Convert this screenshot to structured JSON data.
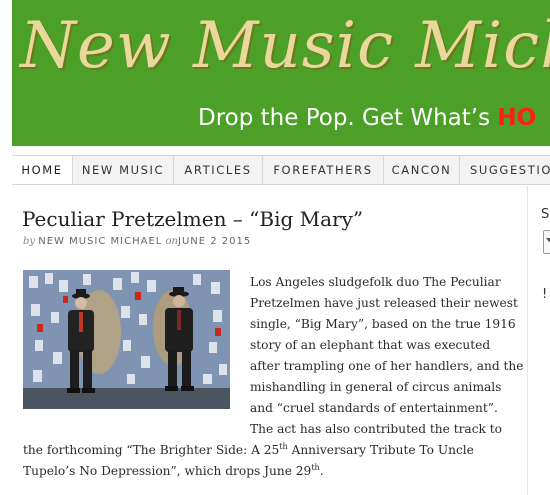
{
  "header": {
    "site_title": "New Music Michael",
    "tagline_prefix": "Drop the Pop. Get What’s ",
    "tagline_hot": "HO",
    "bg_color": "#4ca028",
    "title_color": "#ead79b",
    "hot_color": "#ff1e16"
  },
  "nav": {
    "items": [
      {
        "label": "HOME",
        "active": true
      },
      {
        "label": "NEW MUSIC",
        "active": false
      },
      {
        "label": "ARTICLES",
        "active": false
      },
      {
        "label": "FOREFATHERS",
        "active": false
      },
      {
        "label": "CANCON",
        "active": false
      },
      {
        "label": "SUGGESTIO",
        "active": false
      }
    ]
  },
  "post": {
    "title": "Peculiar Pretzelmen – “Big Mary”",
    "by": "by",
    "author": "NEW MUSIC MICHAEL",
    "on": "on",
    "date": "JUNE 2 2015",
    "lines": [
      "Los Angeles sludgefolk duo The Peculiar",
      "Pretzelmen have just released their newest",
      "single, “Big Mary”, based on the true 1916",
      "story of an elephant that was executed",
      "after trampling one of her handlers, and the",
      "mishandling in general of circus animals",
      "and “cruel standards of entertainment”.",
      "The act has also contributed the track to"
    ],
    "line9_a": "the forthcoming “The Brighter Side: A 25",
    "line9_sup": "th",
    "line9_b": " Anniversary Tribute To Uncle",
    "line10_a": "Tupelo’s No Depression”, which drops June 29",
    "line10_sup": "th",
    "line10_b": "."
  },
  "sidebar": {
    "heading_fragment": "S",
    "fragment_2": "!"
  }
}
